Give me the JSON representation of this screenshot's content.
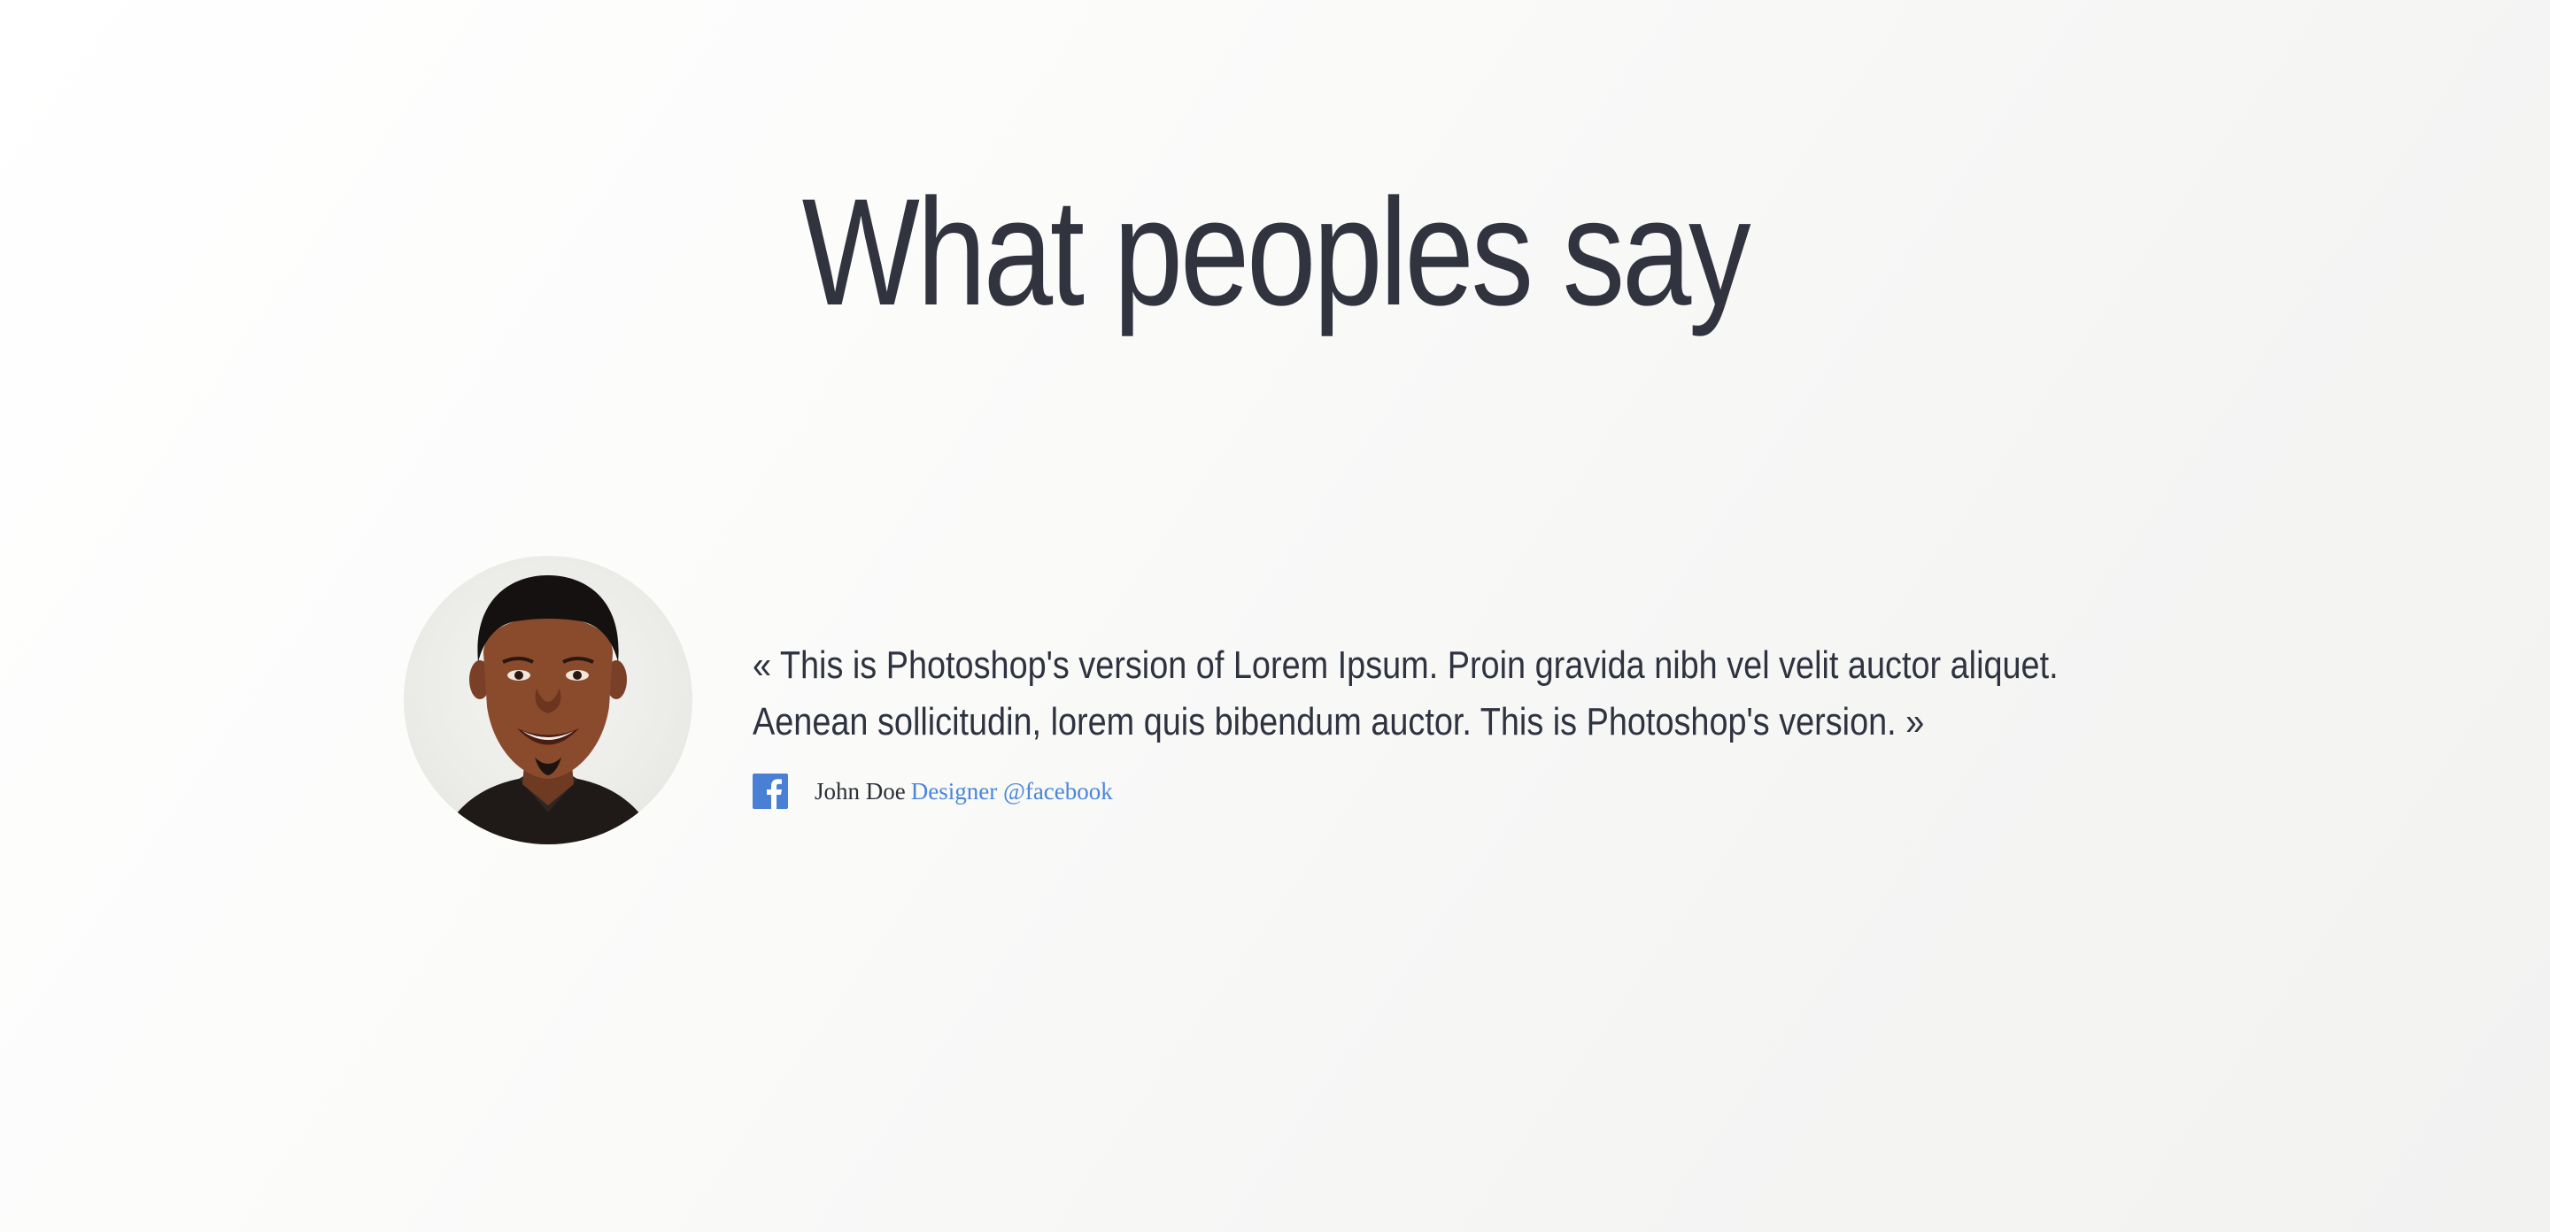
{
  "section": {
    "title": "What peoples say"
  },
  "testimonial": {
    "quote_line_1": "«  This is Photoshop's version  of Lorem Ipsum. Proin gravida nibh vel velit auctor aliquet.",
    "quote_line_2": "Aenean sollicitudin, lorem quis bibendum auctor. This is Photoshop's version. »",
    "author_name": "John Doe",
    "author_role": "Designer @facebook",
    "social_icon": "facebook-icon"
  },
  "colors": {
    "heading": "#31343f",
    "text": "#2f3340",
    "link": "#4a86d8",
    "facebook": "#4a7fd6"
  }
}
